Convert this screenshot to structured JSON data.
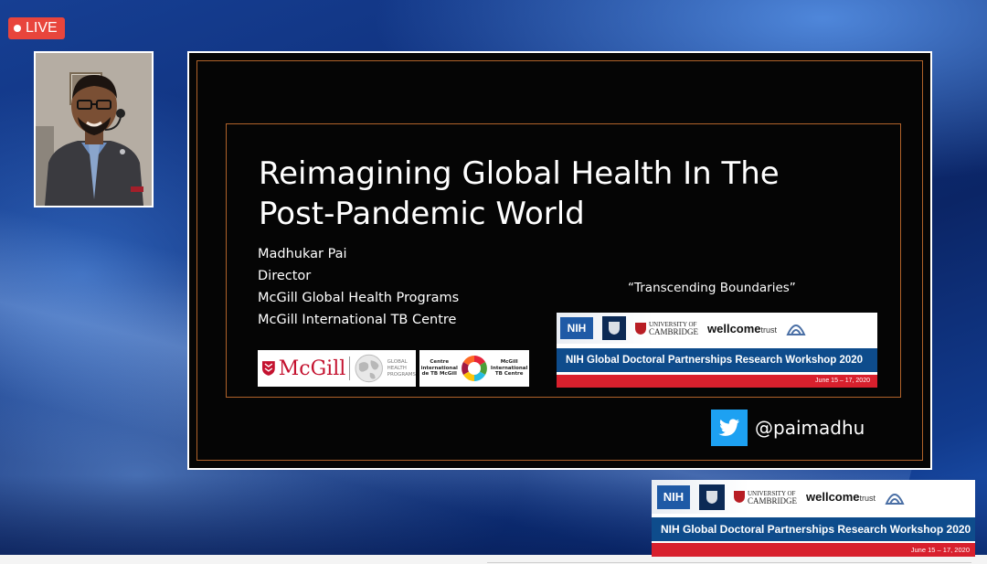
{
  "live_badge": {
    "label": "LIVE"
  },
  "slide": {
    "title_line1": "Reimagining Global Health In The",
    "title_line2": "Post-Pandemic World",
    "presenter": {
      "name": "Madhukar Pai",
      "role": "Director",
      "org1": "McGill Global Health Programs",
      "org2": "McGill International TB Centre"
    },
    "mcgill_logo": {
      "name": "McGill",
      "programs_line1": "GLOBAL",
      "programs_line2": "HEALTH",
      "programs_line3": "PROGRAMS"
    },
    "tb_logo": {
      "left_line1": "Centre",
      "left_line2": "international",
      "left_line3": "de TB McGill",
      "right_line1": "McGill",
      "right_line2": "International",
      "right_line3": "TB Centre"
    },
    "tagline": "“Transcending Boundaries”",
    "twitter_handle": "@paimadhu"
  },
  "workshop_banner": {
    "nih": "NIH",
    "cambridge_line1": "UNIVERSITY OF",
    "cambridge_line2": "CAMBRIDGE",
    "wellcome": "wellcome",
    "trust": "trust",
    "title": "NIH Global Doctoral Partnerships Research Workshop 2020",
    "dates": "June 15 – 17, 2020"
  },
  "colors": {
    "live_red": "#e8453c",
    "slide_border_accent": "#b0622a",
    "banner_blue": "#0e4c8c",
    "banner_red": "#d8202d",
    "twitter_blue": "#1da1f2"
  },
  "icons": [
    "live-dot-icon",
    "twitter-bird-icon",
    "mcgill-shield-icon",
    "globe-icon",
    "sdg-wheel-icon",
    "oxford-crest-icon",
    "cambridge-shield-icon",
    "nr-logo-icon"
  ]
}
